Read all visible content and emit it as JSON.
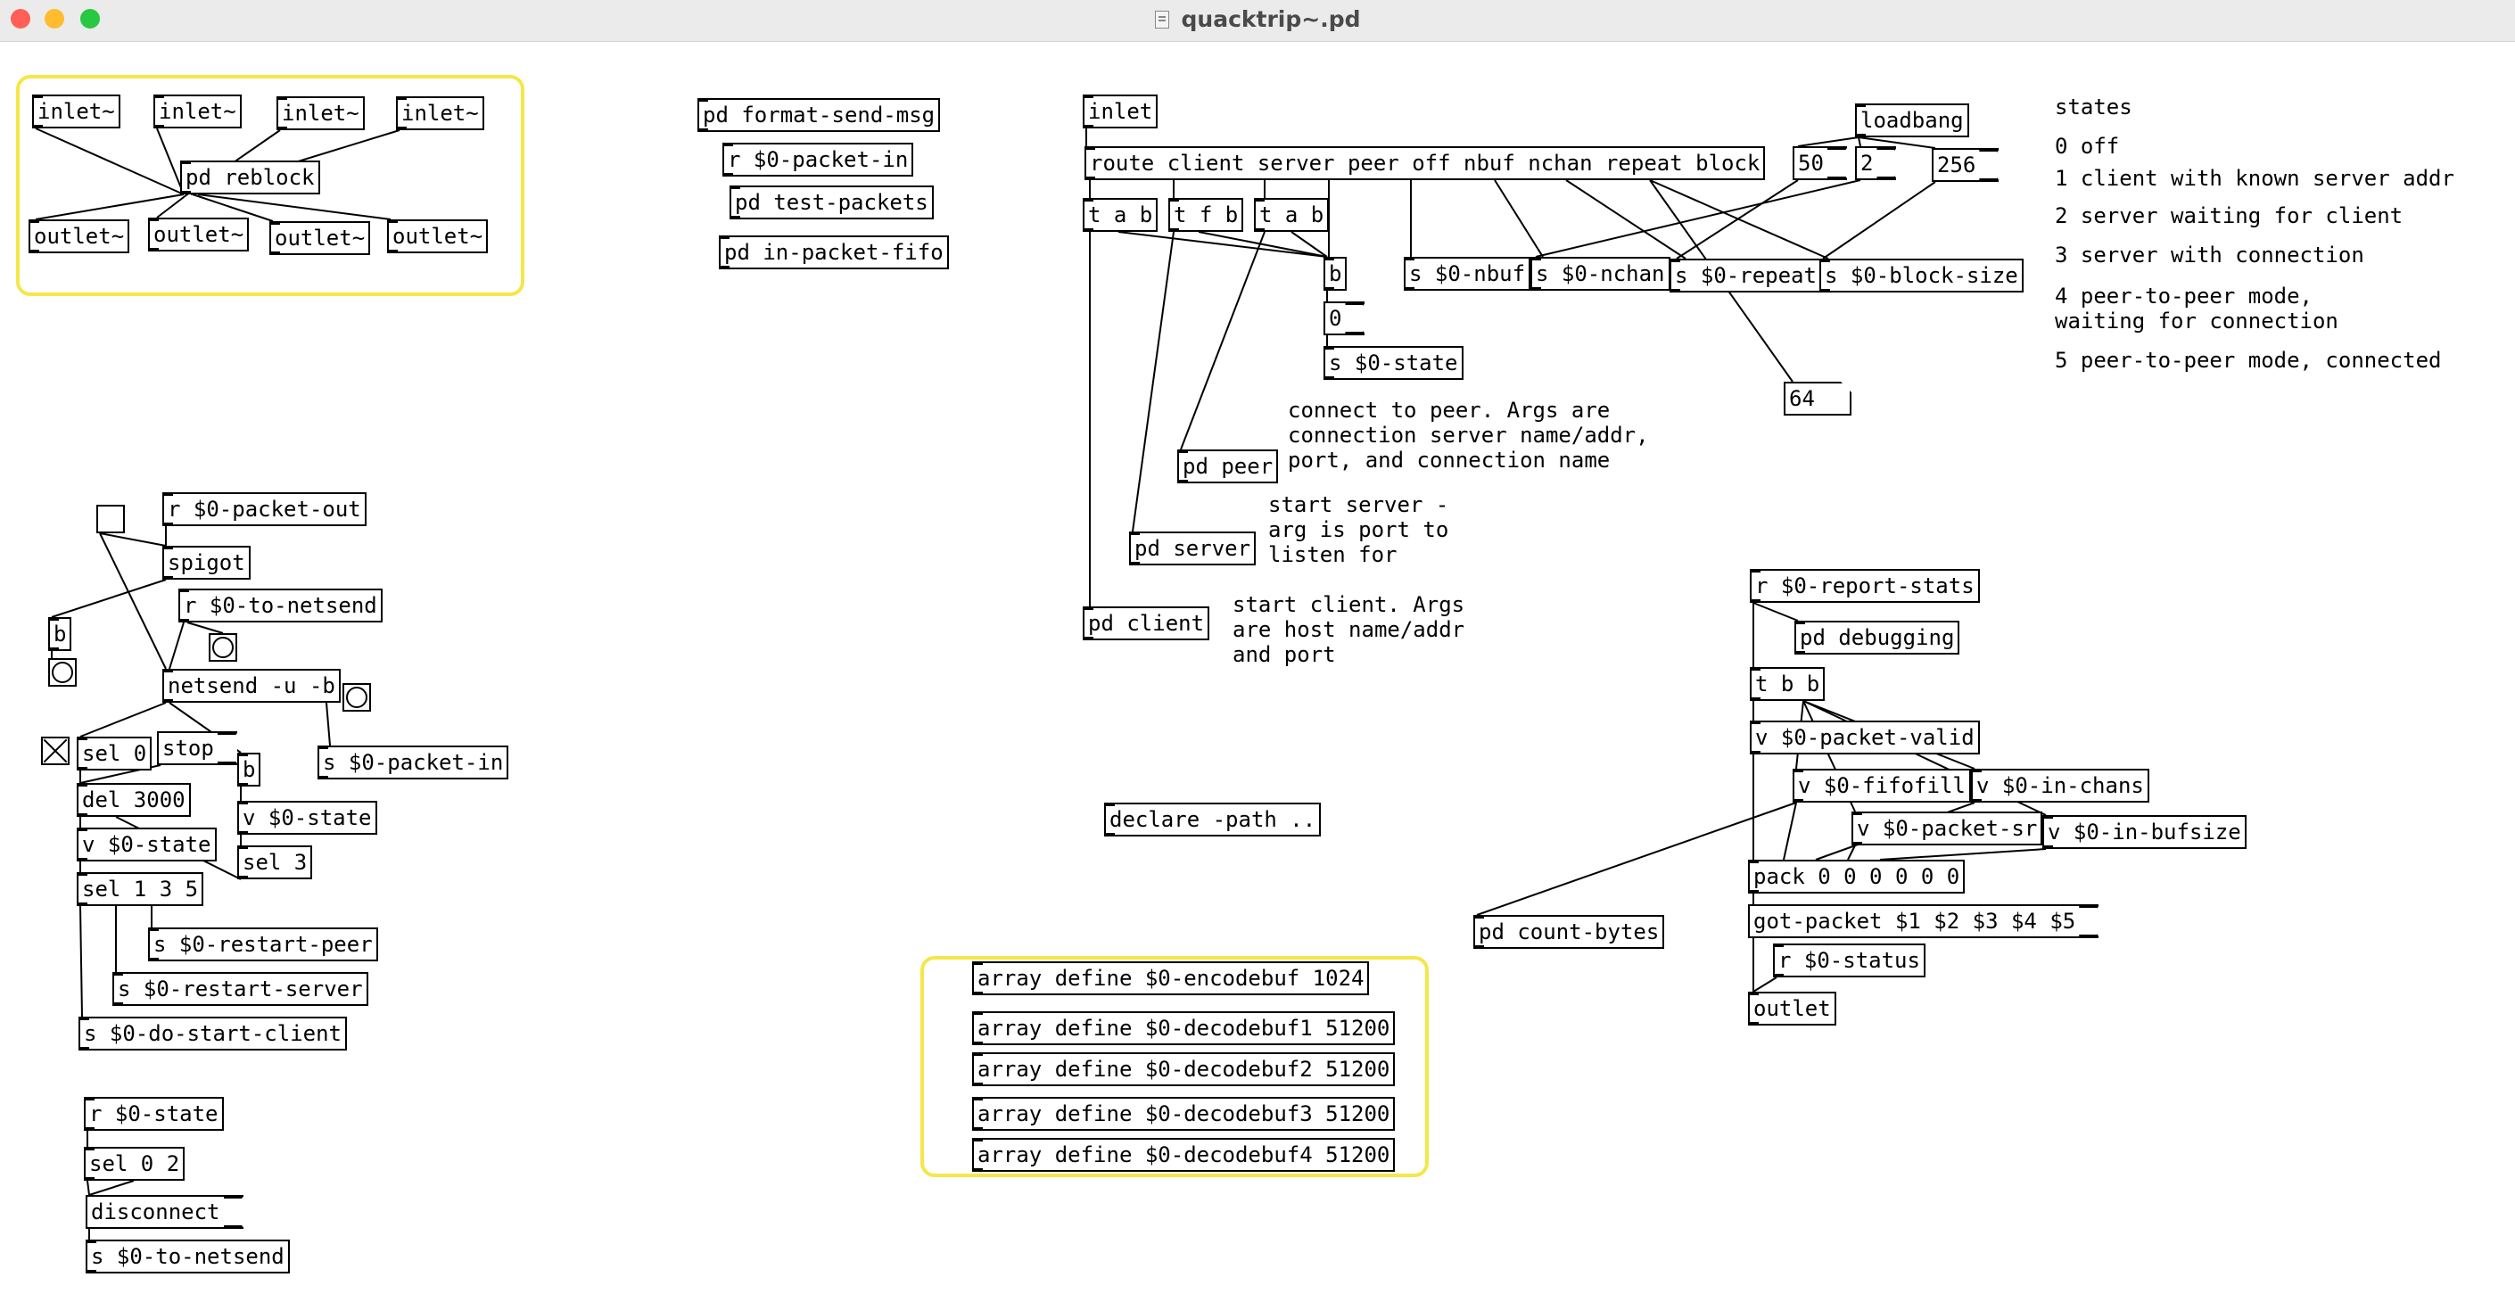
{
  "window": {
    "title": "quacktrip~.pd",
    "traffic_lights": {
      "close": "#ff5f57",
      "minimize": "#febc2e",
      "zoom": "#28c840"
    }
  },
  "colors": {
    "group_highlight": "#f5e64a",
    "wire": "#000000"
  },
  "icons": {
    "document": "document-icon",
    "bang": "bang-circle",
    "toggle": "toggle-box"
  },
  "objects": {
    "inlet_1": "inlet~",
    "inlet_2": "inlet~",
    "inlet_3": "inlet~",
    "inlet_4": "inlet~",
    "pd_reblock": "pd reblock",
    "outlet_1": "outlet~",
    "outlet_2": "outlet~",
    "outlet_3": "outlet~",
    "outlet_4": "outlet~",
    "pd_format_send_msg": "pd format-send-msg",
    "r_packet_in": "r $0-packet-in",
    "pd_test_packets": "pd test-packets",
    "pd_in_packet_fifo": "pd in-packet-fifo",
    "inlet_ctl": "inlet",
    "route": "route client server peer off nbuf nchan repeat block",
    "loadbang": "loadbang",
    "t_a_b_1": "t a b",
    "t_f_b": "t f b",
    "t_a_b_2": "t a b",
    "b_mid": "b",
    "s_nbuf": "s $0-nbuf",
    "s_nchan": "s $0-nchan",
    "s_repeat": "s $0-repeat",
    "s_block_size": "s $0-block-size",
    "s_state_mid": "s $0-state",
    "pd_peer": "pd peer",
    "pd_server": "pd server",
    "pd_client": "pd client",
    "r_packet_out": "r $0-packet-out",
    "spigot": "spigot",
    "r_to_netsend": "r $0-to-netsend",
    "b_left": "b",
    "netsend": "netsend -u -b",
    "sel_0": "sel 0",
    "b_left2": "b",
    "s_packet_in": "s $0-packet-in",
    "del_3000": "del 3000",
    "v_state_1": "v $0-state",
    "v_state_2": "v $0-state",
    "sel_3": "sel 3",
    "sel_1_3_5": "sel 1 3 5",
    "s_restart_peer": "s $0-restart-peer",
    "s_restart_server": "s $0-restart-server",
    "s_do_start_client": "s $0-do-start-client",
    "r_state": "r $0-state",
    "sel_0_2": "sel 0 2",
    "s_to_netsend": "s $0-to-netsend",
    "declare": "declare -path ..",
    "r_report_stats": "r $0-report-stats",
    "pd_debugging": "pd debugging",
    "t_b_b": "t b b",
    "v_packet_valid": "v $0-packet-valid",
    "v_fifofill": "v $0-fifofill",
    "v_in_chans": "v $0-in-chans",
    "v_packet_sr": "v $0-packet-sr",
    "v_in_bufsize": "v $0-in-bufsize",
    "pack": "pack 0 0 0 0 0 0",
    "pd_count_bytes": "pd count-bytes",
    "r_status": "r $0-status",
    "outlet_main": "outlet",
    "array_encode": "array define $0-encodebuf 1024",
    "array_decode1": "array define $0-decodebuf1 51200",
    "array_decode2": "array define $0-decodebuf2 51200",
    "array_decode3": "array define $0-decodebuf3 51200",
    "array_decode4": "array define $0-decodebuf4 51200"
  },
  "messages": {
    "msg_50": "50",
    "msg_2": "2",
    "msg_256": "256",
    "msg_0": "0",
    "msg_stop": "stop",
    "msg_disconnect": "disconnect",
    "msg_got_packet": "got-packet $1 $2 $3 $4 $5"
  },
  "number_boxes": {
    "num_64": "64"
  },
  "comments": {
    "states_title": "states",
    "state_0": "0 off",
    "state_1": "1 client with known server addr",
    "state_2": "2 server waiting for client",
    "state_3": "3 server with connection",
    "state_4": "4 peer-to-peer mode,\nwaiting for connection",
    "state_5": "5 peer-to-peer mode, connected",
    "connect_peer": "connect to peer. Args are\nconnection server name/addr,\nport, and connection name",
    "start_server": "start server -\narg is port to\nlisten for",
    "start_client": "start client. Args\nare host name/addr\nand port"
  }
}
